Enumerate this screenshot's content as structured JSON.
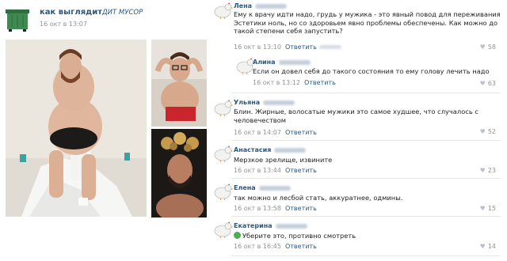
{
  "post": {
    "group_name": "как выглядит",
    "group_name_suffix": "ДИТ МУСОР",
    "date": "16 окт в 13:07"
  },
  "comments": [
    {
      "name": "Лена",
      "text": "Ему к врачу идти надо, грудь у мужика - это явный повод для переживания Эстетики ноль, но со здоровьем явно проблемы обеспечены. Как можно до такой степени себя запустить?",
      "date": "16 окт в 13:10",
      "reply": "Ответить",
      "likes": "58"
    },
    {
      "name": "Алина",
      "text": "Если он довел себя до такого состояния то ему голову лечить надо",
      "date": "16 окт в 13:12",
      "reply": "Ответить",
      "likes": "63"
    },
    {
      "name": "Ульяна",
      "text": "Блин. Жирные, волосатые мужики это самое худшее, что случалось с человечеством",
      "date": "16 окт в 14:07",
      "reply": "Ответить",
      "likes": "52"
    },
    {
      "name": "Анастасия",
      "text": "Мерзкое зрелище, извините",
      "date": "16 окт в 13:44",
      "reply": "Ответить",
      "likes": "23"
    },
    {
      "name": "Елена",
      "text": "так можно и лесбой стать, аккуратнее, одмины.",
      "date": "16 окт в 13:58",
      "reply": "Ответить",
      "likes": "15"
    },
    {
      "name": "Екатерина",
      "text": "Уберите это, противно смотреть",
      "date": "16 окт в 16:45",
      "reply": "Ответить",
      "likes": "14"
    }
  ]
}
